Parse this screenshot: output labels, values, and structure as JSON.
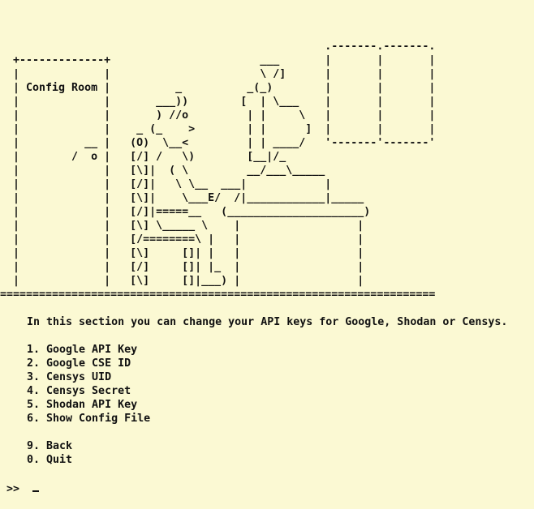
{
  "banner": {
    "art": "                                                  .-------.-------.\n  +-------------+                       ___       |       |       |\n  |             |                       \\ /]      |       |       |\n  | Config Room |          _          _(_)        |       |       |\n  |             |       ___))        [  | \\___    |       |       |\n  |             |       ) //o         | |     \\   |       |       |\n  |             |    _ (_    >        | |      ]  |       |       |\n  |          __ |   (O)  \\__<         | | ____/   '-------'-------'\n  |        /  o |   [/] /   \\)        [__|/_\n  |             |   [\\]|  ( \\         __/___\\_____\n  |             |   [/]|   \\ \\__  ___|            |\n  |             |   [\\]|    \\___E/  /|____________|_____\n  |             |   [/]|=====__   (_____________________)\n  |             |   [\\] \\_____ \\    |                  |\n  |             |   [/========\\ |   |                  |\n  |             |   [\\]     []| |   |                  |\n  |             |   [/]     []| |_  |                  |\n  |             |   [\\]     []|___) |                  |\n==================================================================="
  },
  "intro": "In this section you can change your API keys for Google, Shodan or Censys.",
  "menu": {
    "items": [
      "1. Google API Key",
      "2. Google CSE ID",
      "3. Censys UID",
      "4. Censys Secret",
      "5. Shodan API Key",
      "6. Show Config File"
    ],
    "nav": [
      "9. Back",
      "0. Quit"
    ]
  },
  "prompt": {
    "symbol": ">>",
    "value": ""
  },
  "colors": {
    "background": "#fbf9d3",
    "foreground": "#111111"
  }
}
